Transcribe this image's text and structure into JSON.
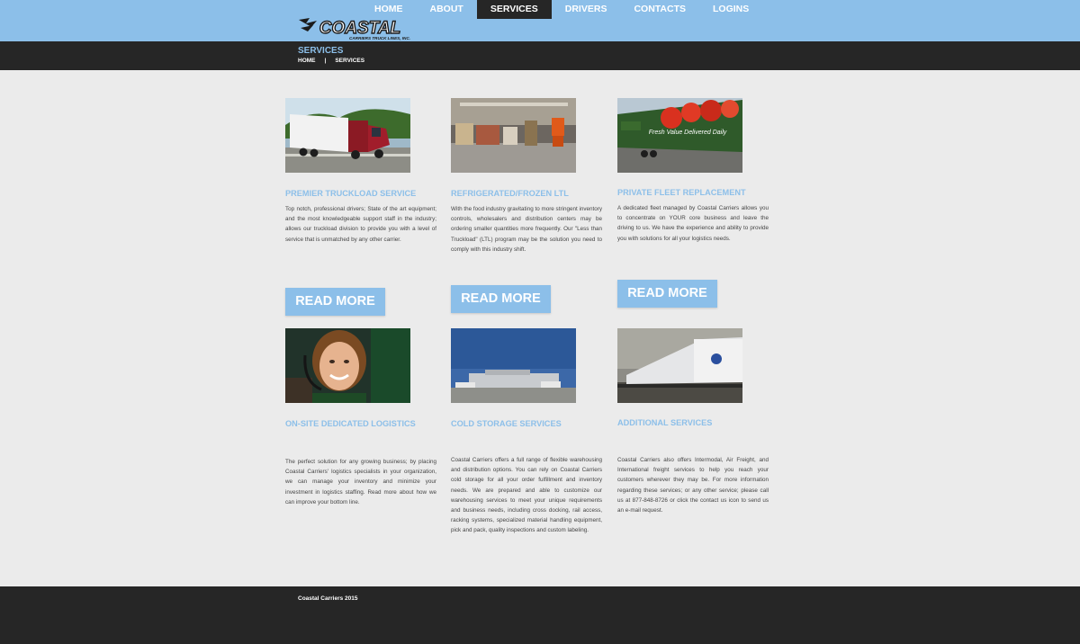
{
  "header": {
    "logo_text": "COASTAL",
    "logo_subtext": "CARRIERS TRUCK LINES, INC.",
    "nav": [
      {
        "label": "HOME"
      },
      {
        "label": "ABOUT"
      },
      {
        "label": "SERVICES"
      },
      {
        "label": "DRIVERS"
      },
      {
        "label": "CONTACTS"
      },
      {
        "label": "LOGINS"
      }
    ],
    "active_nav": "SERVICES"
  },
  "subheader": {
    "title": "SERVICES",
    "breadcrumb": {
      "home": "HOME",
      "separator": "|",
      "current": "SERVICES"
    }
  },
  "services": [
    {
      "heading": "PREMIER TRUCKLOAD SERVICE",
      "description": "Top notch, professional drivers; State of the art equipment; and the most knowledgeable support staff in the industry; allows our truckload division to provide you with a level of service that is unmatched by any other carrier.",
      "button": "READ MORE"
    },
    {
      "heading": "REFRIGERATED/FROZEN LTL",
      "description": "With the food industry gravitating to more stringent inventory controls, wholesalers and distribution centers may be ordering smaller quantities more frequently. Our \"Less than Truckload\" (LTL) program may be the solution you need to comply with this industry shift.",
      "button": "READ MORE"
    },
    {
      "heading": "PRIVATE FLEET REPLACEMENT",
      "description": "A dedicated fleet managed by Coastal Carriers allows you to concentrate on YOUR core business and leave the driving to us. We have the experience and ability to provide you with solutions for all your logistics needs.",
      "button": "READ MORE",
      "photo_text": "Fresh Value Delivered Daily"
    },
    {
      "heading": "ON-SITE DEDICATED LOGISTICS",
      "description": "The perfect solution for any growing business; by placing Coastal Carriers' logistics specialists in your organization, we can manage your inventory and minimize your investment in logistics staffing. Read more about how we can improve your bottom line."
    },
    {
      "heading": "COLD STORAGE SERVICES",
      "description": "Coastal Carriers offers a full range of flexible warehousing and distribution options. You can rely on Coastal Carriers cold storage for all your order fulfillment and inventory needs. We are prepared and able to customize our warehousing services to meet your unique requirements and business needs, including cross docking, rail access, racking systems, specialized material handling equipment, pick and pack, quality inspections and custom labeling."
    },
    {
      "heading": "ADDITIONAL SERVICES",
      "description": "Coastal Carriers also offers Intermodal, Air Freight, and International freight services to help you reach your customers wherever they may be. For more information regarding these services; or any other service; please call us at 877-848-8726 or click the contact us icon to send us an e-mail request."
    }
  ],
  "footer": {
    "text": "Coastal Carriers 2015"
  },
  "colors": {
    "accent": "#8cbfe9",
    "dark": "#262626",
    "background": "#ebebeb"
  }
}
